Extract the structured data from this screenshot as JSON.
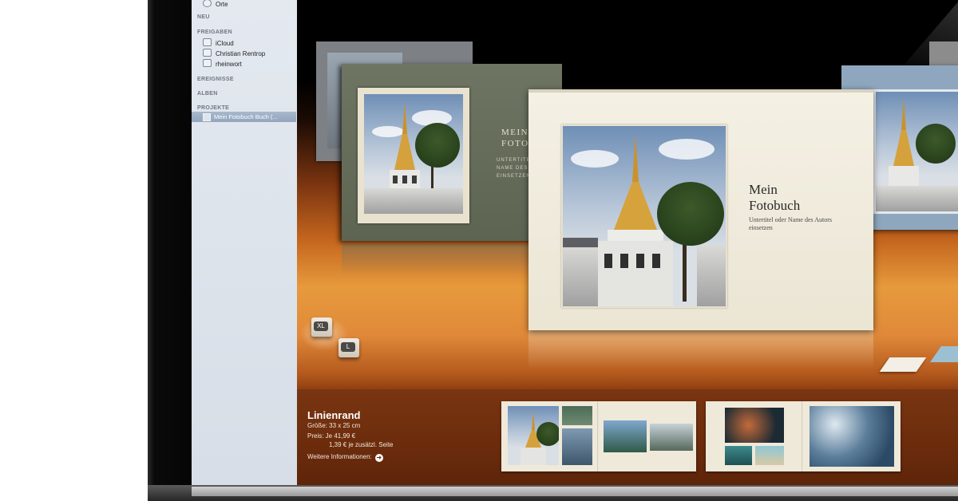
{
  "sidebar": {
    "items_top": [
      {
        "label": "Orte",
        "icon": "globe-icon"
      }
    ],
    "heading_neu": "NEU",
    "heading_freigaben": "FREIGABEN",
    "freigaben": [
      {
        "label": "iCloud",
        "icon": "cloud-icon"
      },
      {
        "label": "Christian Rentrop",
        "icon": "user-icon"
      },
      {
        "label": "rheinwort",
        "icon": "share-icon"
      }
    ],
    "heading_ereignisse": "EREIGNISSE",
    "heading_alben": "ALBEN",
    "heading_projekte": "PROJEKTE",
    "selected_project": "Mein Fotobuch Buch (...",
    "selected_icon": "book-icon"
  },
  "stage": {
    "green_book": {
      "title_line1": "MEIN",
      "title_line2": "FOTOBUCH",
      "subtitle": "UNTERTITEL ODER NAME DES AUTORS EINSETZEN"
    },
    "main_book": {
      "title_line1": "Mein",
      "title_line2": "Fotobuch",
      "subtitle": "Untertitel oder Name des Autors einsetzen"
    },
    "size_cubes": [
      {
        "label": "XL"
      },
      {
        "label": "L"
      }
    ]
  },
  "info": {
    "title": "Linienrand",
    "size": "Größe: 33 x 25 cm",
    "price": "Preis: Je 41,99 €",
    "extra": "1,39 € je zusätzl. Seite",
    "more": "Weitere Informationen:",
    "more_icon": "arrow-right-icon"
  },
  "colors": {
    "stage_orange": "#c4651e",
    "bottom_brown": "#6b2c0c",
    "sidebar_bg": "#dfe5ec",
    "selection": "#9aabc1"
  }
}
